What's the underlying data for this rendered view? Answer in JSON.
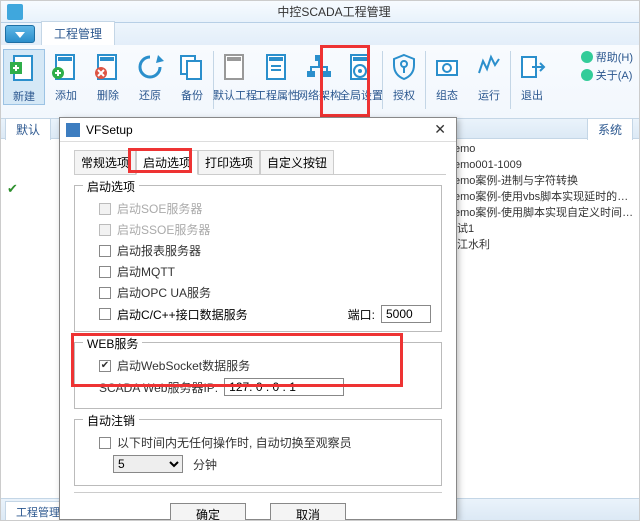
{
  "window": {
    "title": "中控SCADA工程管理"
  },
  "ribbon_tab": "工程管理",
  "ribbon": {
    "new": "新建",
    "add": "添加",
    "delete": "删除",
    "restore": "还原",
    "backup": "备份",
    "default_proj": "默认工程",
    "proj_attr": "工程属性",
    "net_arch": "网络架构",
    "global_set": "全局设置",
    "auth": "授权",
    "config": "组态",
    "run": "运行",
    "exit": "退出",
    "help": "帮助(H)",
    "about": "关于(A)"
  },
  "project_tab_left": "默认",
  "project_tab_right": "系统",
  "tree": [
    "ECT\\Demo",
    "ECT\\Demo001-1009",
    "ECT\\Demo案例-进制与字符转换",
    "ECT\\Demo案例-使用vbs脚本实现延时的几...",
    "ECT\\Demo案例-使用脚本实现自定义时间日..",
    "ECT\\测试1",
    "ECT\\峡江水利"
  ],
  "bottom_tab": "工程管理",
  "dialog": {
    "title": "VFSetup",
    "tabs": {
      "t1": "常规选项",
      "t2": "启动选项",
      "t3": "打印选项",
      "t4": "自定义按钮"
    },
    "group_start": "启动选项",
    "chk_soe": "启动SOE服务器",
    "chk_ssoe": "启动SSOE服务器",
    "chk_report": "启动报表服务器",
    "chk_mqtt": "启动MQTT",
    "chk_opcua": "启动OPC UA服务",
    "chk_ccpp": "启动C/C++接口数据服务",
    "port_label": "端口:",
    "port_value": "5000",
    "group_web": "WEB服务",
    "chk_ws": "启动WebSocket数据服务",
    "ip_label": "SCADA Web服务器IP:",
    "ip_value": "127. 0 . 0 . 1",
    "group_auto": "自动注销",
    "chk_auto": "以下时间内无任何操作时, 自动切换至观察员",
    "minutes_value": "5",
    "minutes_unit": "分钟",
    "ok": "确定",
    "cancel": "取消"
  }
}
